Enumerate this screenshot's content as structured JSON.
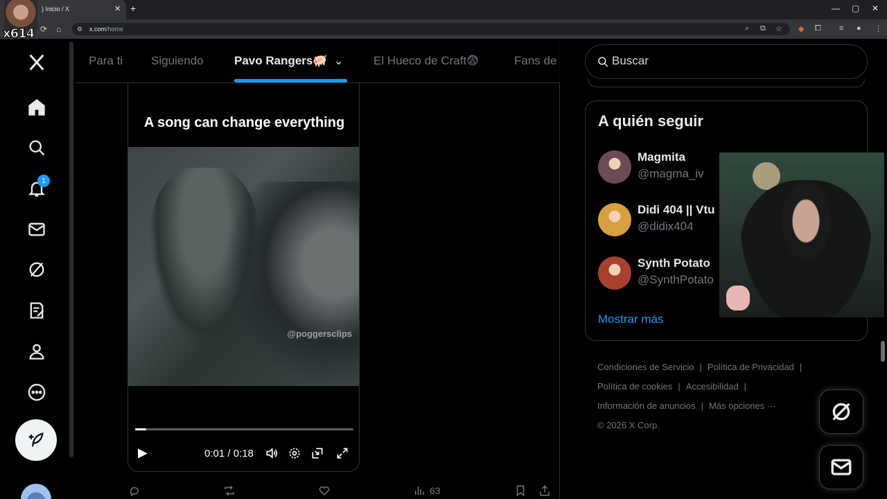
{
  "browser": {
    "tab_title": ") Inicio / X",
    "url_host": "x.com",
    "url_path": "/home",
    "new_tab_icon": "plus-icon",
    "close_icon": "close-icon"
  },
  "overlay": {
    "streamer_tag": "x614"
  },
  "nav": {
    "items": [
      "x-logo-icon",
      "home-icon",
      "search-icon",
      "notifications-icon",
      "messages-icon",
      "grok-icon",
      "lists-icon",
      "profile-icon",
      "more-icon"
    ],
    "notification_count": "1",
    "compose_icon": "compose-icon"
  },
  "feed": {
    "tabs": [
      "Para ti",
      "Siguiendo",
      "Pavo Rangers",
      "El Hueco de Craft😨",
      "Fans de"
    ],
    "active_tab": "Pavo Rangers",
    "tab_emoji": "🐖"
  },
  "video": {
    "caption": "A song can change everything",
    "watermark": "@poggersclips",
    "time": "0:01 / 0:18",
    "progress": 0.05,
    "controls": [
      "play-icon",
      "volume-icon",
      "settings-icon",
      "pip-icon",
      "fullscreen-icon"
    ]
  },
  "post_actions": {
    "views": "63",
    "icons": [
      "reply-icon",
      "repost-icon",
      "like-icon",
      "views-icon",
      "bookmark-icon",
      "share-icon"
    ]
  },
  "search": {
    "placeholder": "Buscar"
  },
  "who_to_follow": {
    "title": "A quién seguir",
    "users": [
      {
        "name": "Magmita",
        "handle": "@magma_iv",
        "avatar_color": "#6e4a55"
      },
      {
        "name": "Didi 404 || Vtu",
        "handle": "@didix404",
        "avatar_color": "#d8a03a"
      },
      {
        "name": "Synth Potato",
        "handle": "@SynthPotato",
        "avatar_color": "#a8402e"
      }
    ],
    "show_more": "Mostrar más"
  },
  "footer": {
    "links": [
      "Condiciones de Servicio",
      "Política de Privacidad",
      "Política de cookies",
      "Accesibilidad",
      "Información de anuncios",
      "Más opciones ···"
    ],
    "copyright": "© 2026 X Corp."
  },
  "colors": {
    "accent": "#1d9bf0",
    "background": "#000000",
    "border": "#2f3336",
    "muted_text": "#71767b"
  }
}
